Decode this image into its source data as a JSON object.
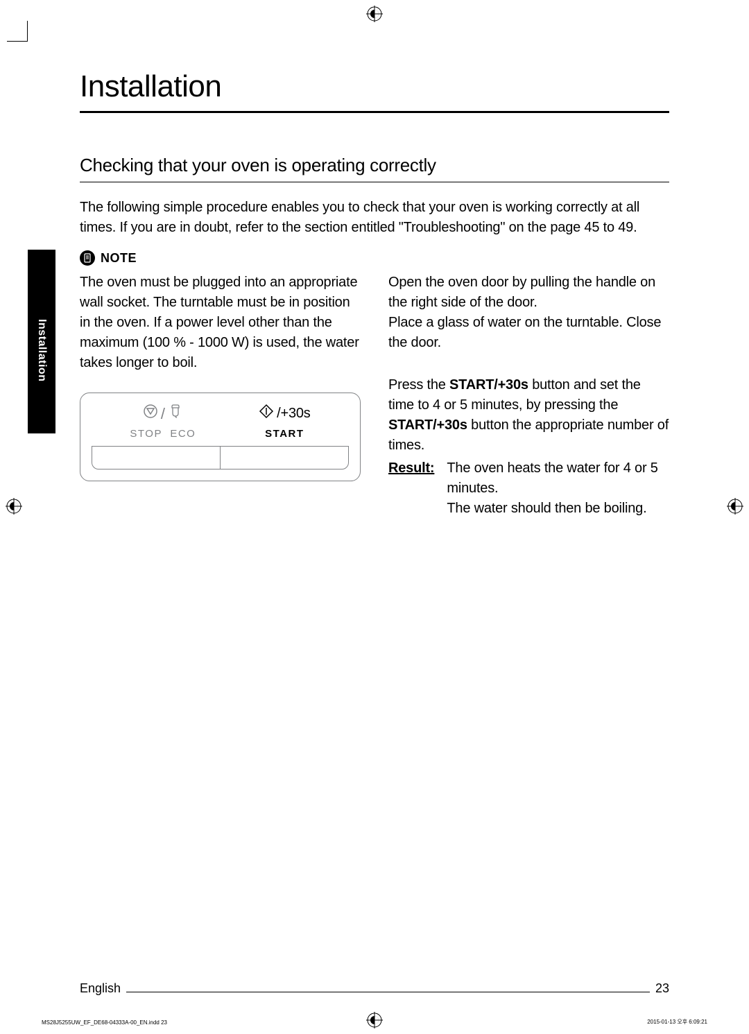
{
  "title": "Installation",
  "subtitle": "Checking that your oven is operating correctly",
  "intro": "The following simple procedure enables you to check that your oven is working correctly at all times. If you are in doubt, refer to the section entitled \"Troubleshooting\" on the page 45 to 49.",
  "note_label": "NOTE",
  "note_text": "The oven must be plugged into an appropriate wall socket. The turntable must be in position in the oven. If a power level other than the maximum (100 % - 1000 W) is used, the water takes longer to boil.",
  "panel": {
    "stop_label": "STOP",
    "eco_label": "ECO",
    "start_label": "START",
    "start_suffix": "/+30s"
  },
  "step1": "Open the oven door by pulling the handle on the right side of the door.\nPlace a glass of water on the turntable. Close the door.",
  "step2_a": "Press the ",
  "step2_b": "START/+30s",
  "step2_c": " button and set the time to 4 or 5 minutes, by pressing the ",
  "step2_d": "START/+30s",
  "step2_e": " button the appropriate number of times.",
  "result_label": "Result:",
  "result_text": "The oven heats the water for 4 or 5 minutes.\nThe water should then be boiling.",
  "side_tab": "Installation",
  "footer_lang": "English",
  "footer_page": "23",
  "imprint_left": "MS28J5255UW_EF_DE68-04333A-00_EN.indd   23",
  "imprint_right": "2015-01-13   오후 6:09:21"
}
